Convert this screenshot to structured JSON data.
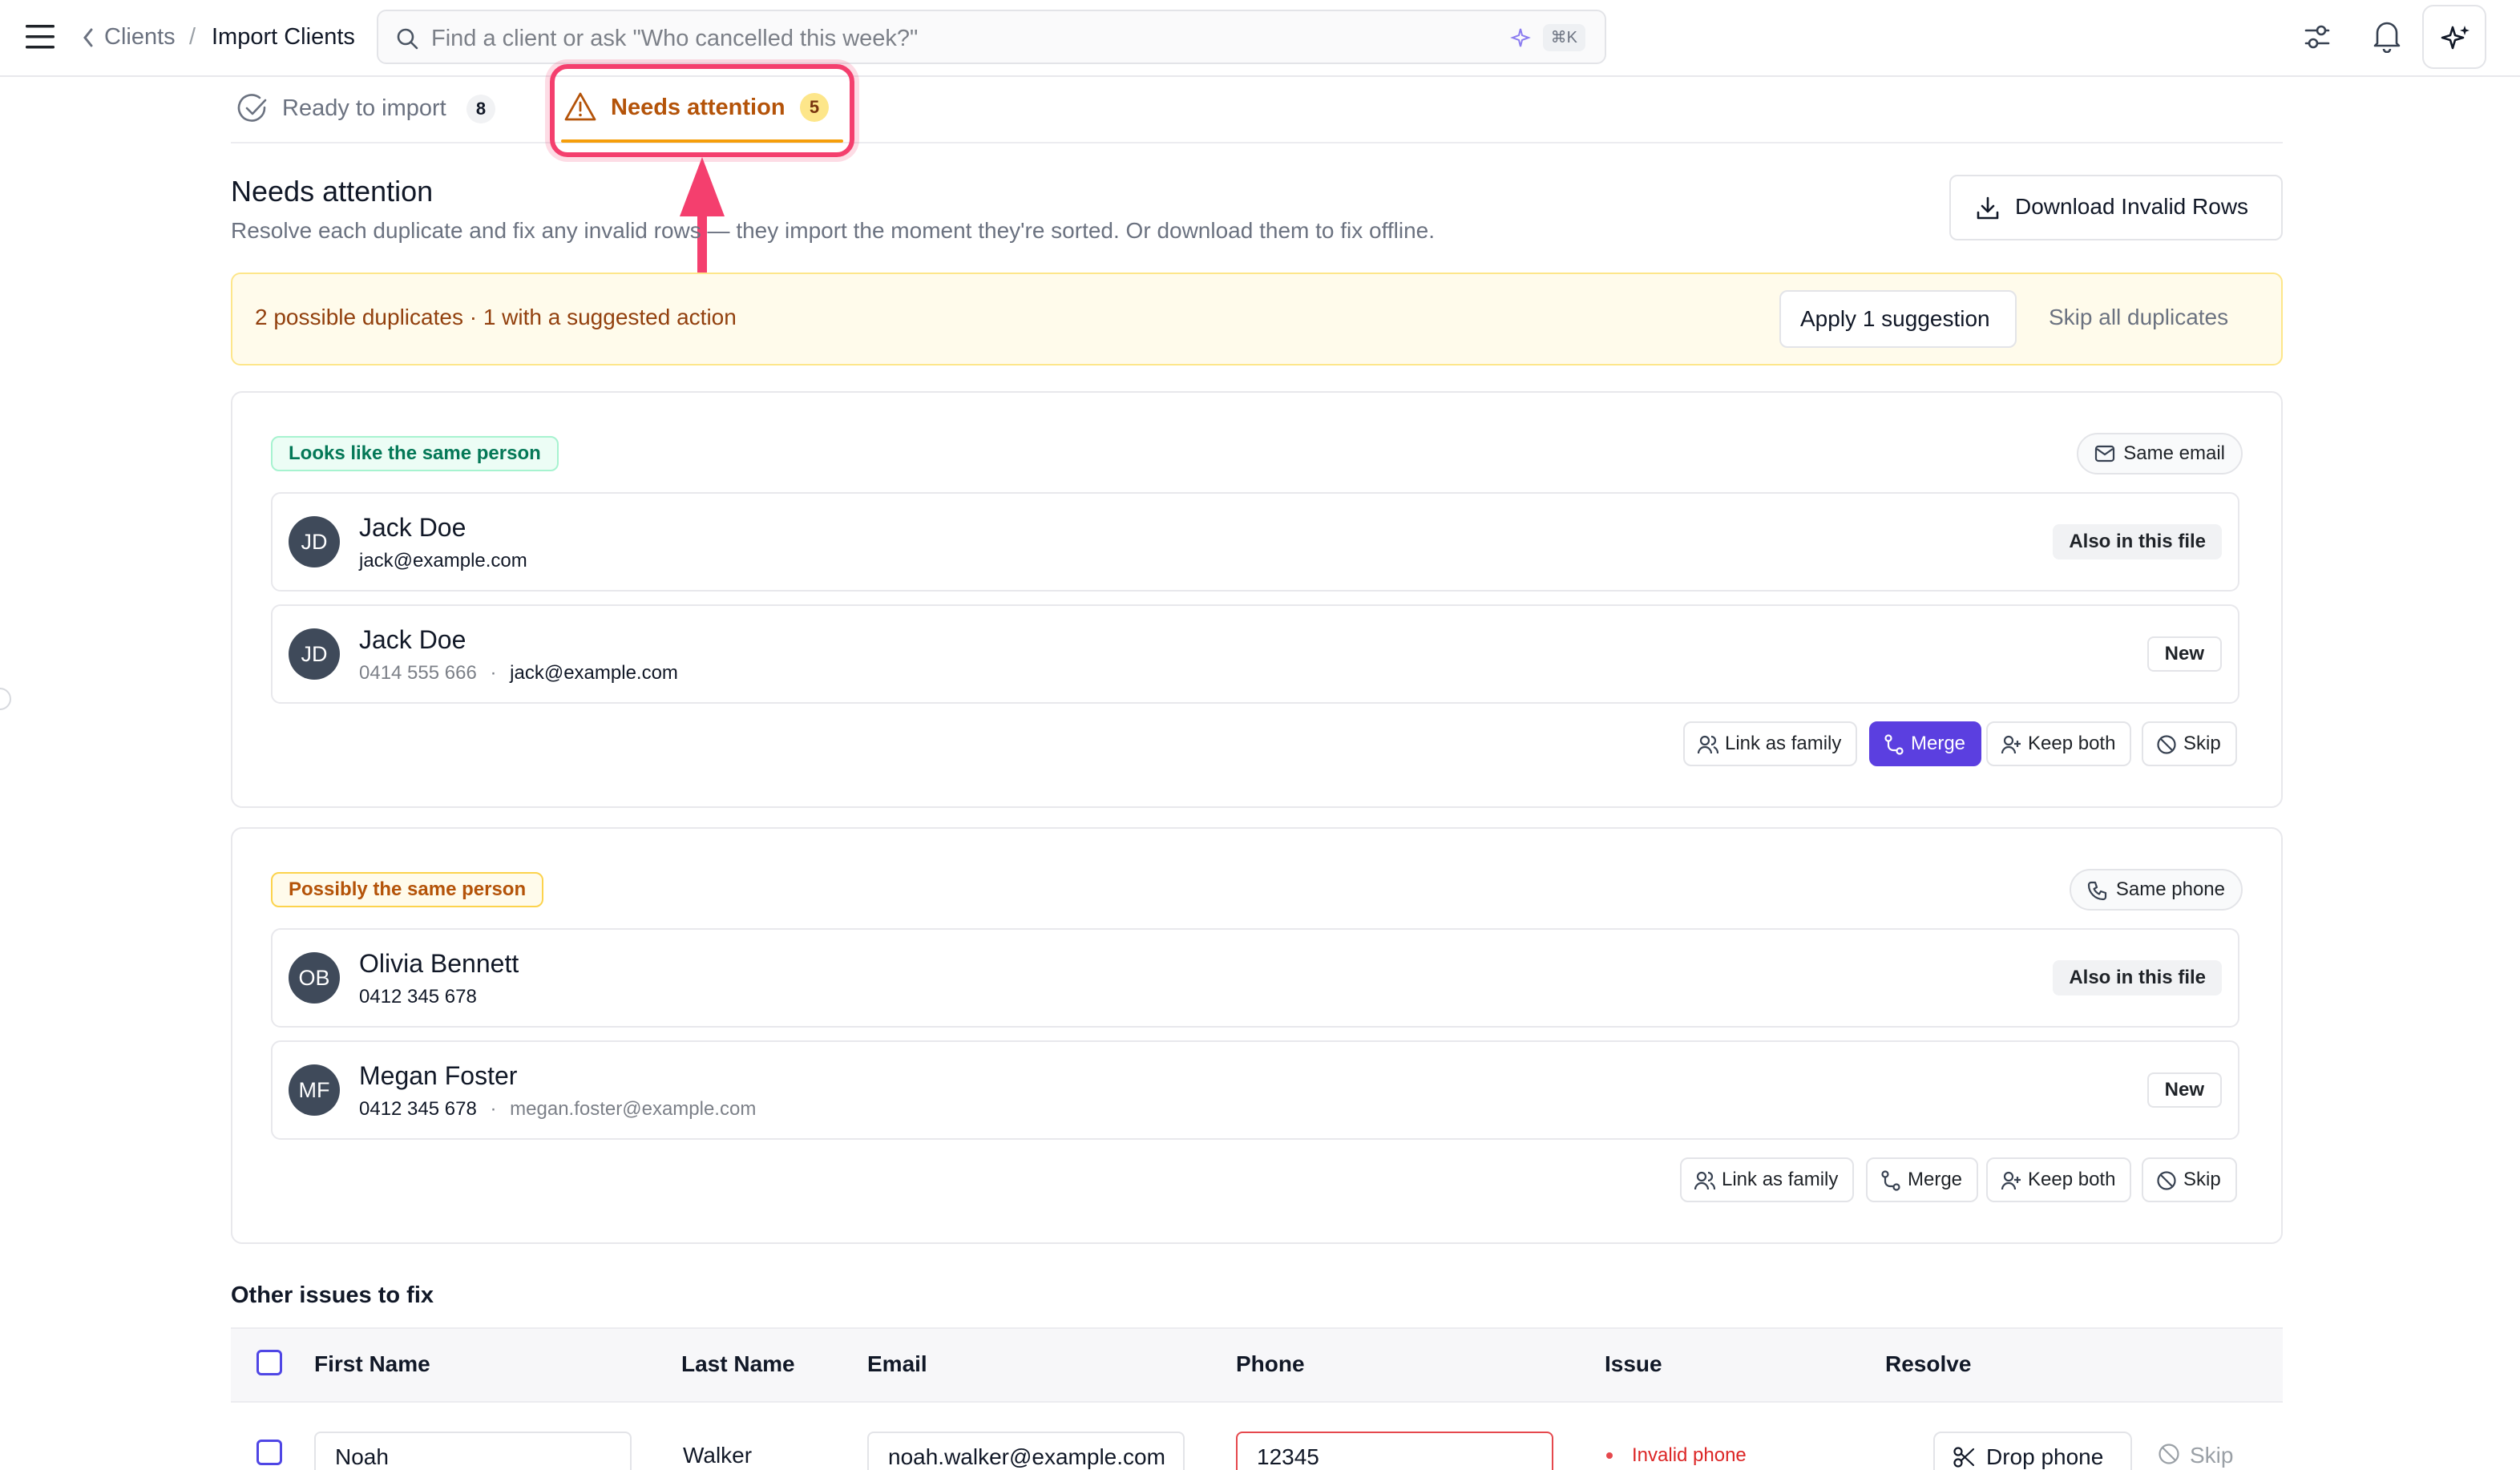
{
  "topbar": {
    "breadcrumb_parent": "Clients",
    "breadcrumb_sep": "/",
    "breadcrumb_current": "Import Clients",
    "search_placeholder": "Find a client or ask \"Who cancelled this week?\"",
    "search_shortcut": "⌘K"
  },
  "tabs": [
    {
      "label": "Ready to import",
      "count": "8"
    },
    {
      "label": "Needs attention",
      "count": "5"
    }
  ],
  "header": {
    "title": "Needs attention",
    "subtitle": "Resolve each duplicate and fix any invalid rows — they import the moment they're sorted. Or download them to fix offline.",
    "download_label": "Download Invalid Rows"
  },
  "banner": {
    "text": "2 possible duplicates · 1 with a suggested action",
    "apply_label": "Apply 1 suggestion",
    "skip_all_label": "Skip all duplicates"
  },
  "groups": [
    {
      "tag": "Looks like the same person",
      "reason": "Same email",
      "people": [
        {
          "initials": "JD",
          "name": "Jack Doe",
          "phone": "",
          "email": "jack@example.com",
          "status": "Also in this file"
        },
        {
          "initials": "JD",
          "name": "Jack Doe",
          "phone": "0414 555 666",
          "email": "jack@example.com",
          "status": "New"
        }
      ],
      "actions": [
        "Link as family",
        "Merge",
        "Keep both",
        "Skip"
      ]
    },
    {
      "tag": "Possibly the same person",
      "reason": "Same phone",
      "people": [
        {
          "initials": "OB",
          "name": "Olivia Bennett",
          "phone": "0412 345 678",
          "email": "",
          "status": "Also in this file"
        },
        {
          "initials": "MF",
          "name": "Megan Foster",
          "phone": "0412 345 678",
          "email": "megan.foster@example.com",
          "status": "New"
        }
      ],
      "actions": [
        "Link as family",
        "Merge",
        "Keep both",
        "Skip"
      ]
    }
  ],
  "separator_dot": "·",
  "issues": {
    "title": "Other issues to fix",
    "columns": [
      "First Name",
      "Last Name",
      "Email",
      "Phone",
      "Issue",
      "Resolve"
    ],
    "rows": [
      {
        "first_name": "Noah",
        "last_name": "Walker",
        "email": "noah.walker@example.com",
        "phone": "12345",
        "issue": "Invalid phone",
        "resolve": "Drop phone",
        "skip": "Skip"
      }
    ]
  },
  "colors": {
    "accent": "#5b3fe0",
    "warning": "#b45309",
    "annotation": "#f43f6e",
    "success_tag": "#047857"
  }
}
